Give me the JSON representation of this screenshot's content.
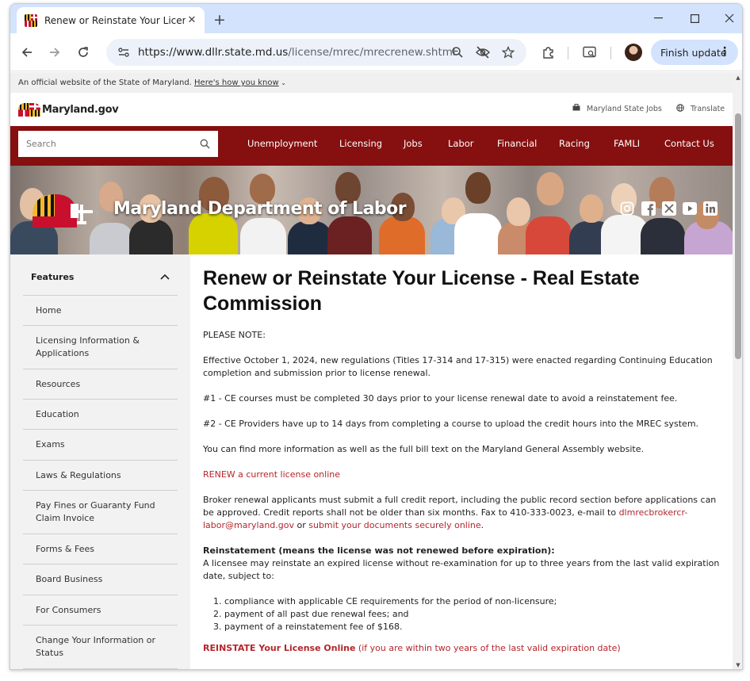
{
  "browser": {
    "tab_title": "Renew or Reinstate Your License",
    "url_host": "https://www.dllr.state.md.us",
    "url_path": "/license/mrec/mrecrenew.shtml",
    "update_label": "Finish update"
  },
  "site": {
    "official_text": "An official website of the State of Maryland. ",
    "official_link": "Here's how you know",
    "gov_name": "Maryland.gov",
    "state_jobs": "Maryland State Jobs",
    "translate": "Translate",
    "search_placeholder": "Search",
    "nav": [
      "Unemployment",
      "Licensing",
      "Jobs",
      "Labor",
      "Financial",
      "Racing",
      "FAMLI",
      "Contact Us"
    ],
    "banner_title": "Maryland Department of Labor"
  },
  "sidebar": {
    "heading": "Features",
    "items": [
      "Home",
      "Licensing Information & Applications",
      "Resources",
      "Education",
      "Exams",
      "Laws & Regulations",
      "Pay Fines or Guaranty Fund Claim Invoice",
      "Forms & Fees",
      "Board Business",
      "For Consumers",
      "Change Your Information or Status"
    ]
  },
  "content": {
    "title": "Renew or Reinstate Your License - Real Estate Commission",
    "note": "PLEASE NOTE:",
    "effective": "Effective October 1, 2024, new regulations (Titles 17-314 and 17-315) were enacted regarding Continuing Education completion and submission prior to license renewal.",
    "rule1": "#1 - CE courses must be completed 30 days prior to your license renewal date to avoid a reinstatement fee.",
    "rule2": "#2 - CE Providers have up to 14 days from completing a course to upload the credit hours into the MREC system.",
    "more_info": "You can find more information as well as the full bill text on the Maryland General Assembly website.",
    "renew_link": "RENEW a current license online",
    "broker_text": "Broker renewal applicants must submit a full credit report, including the public record section before applications can be approved. Credit reports shall not be older than six months. Fax to 410-333-0023, e-mail to ",
    "broker_email": "dlmrecbrokercr-labor@maryland.gov",
    "broker_or": " or ",
    "broker_submit": "submit your documents securely online",
    "broker_end": ".",
    "reinstatement_heading": "Reinstatement (means the license was not renewed before expiration):",
    "reinstatement_text": "A licensee may reinstate an expired license without re-examination for up to three years from the last valid expiration date, subject to:",
    "reinstatement_list": [
      "compliance with applicable CE requirements for the period of non-licensure;",
      "payment of all past due renewal fees; and",
      "payment of a reinstatement fee of $168."
    ],
    "reinstate_link_bold": "REINSTATE Your License Online",
    "reinstate_link_rest": " (if you are within two years of the last valid expiration date)"
  }
}
